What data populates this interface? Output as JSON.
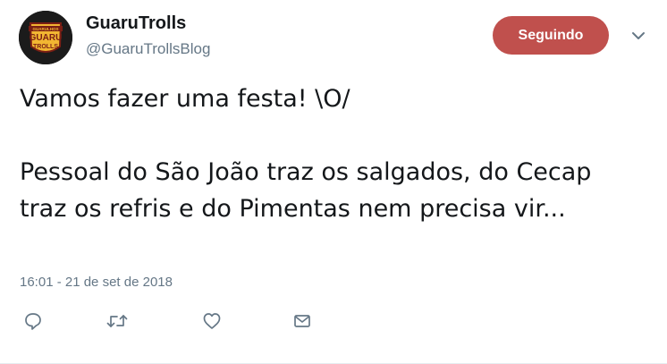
{
  "user": {
    "name": "GuaruTrolls",
    "handle": "@GuaruTrollsBlog",
    "avatar_text": [
      "GUARULHOS",
      "GUARU",
      "TROLLS"
    ]
  },
  "follow_button": {
    "label": "Seguindo"
  },
  "tweet": {
    "paragraphs": [
      "Vamos fazer uma festa! \\O/",
      "Pessoal do São João traz os salgados, do Cecap traz os refris e do Pimentas nem precisa vir..."
    ],
    "timestamp": "16:01 - 21 de set de 2018"
  },
  "actions": {
    "icons": [
      "reply-icon",
      "retweet-icon",
      "like-icon",
      "message-icon"
    ]
  },
  "colors": {
    "accent": "#c0504d",
    "text_primary": "#14171a",
    "text_secondary": "#657786",
    "icon": "#657786"
  }
}
